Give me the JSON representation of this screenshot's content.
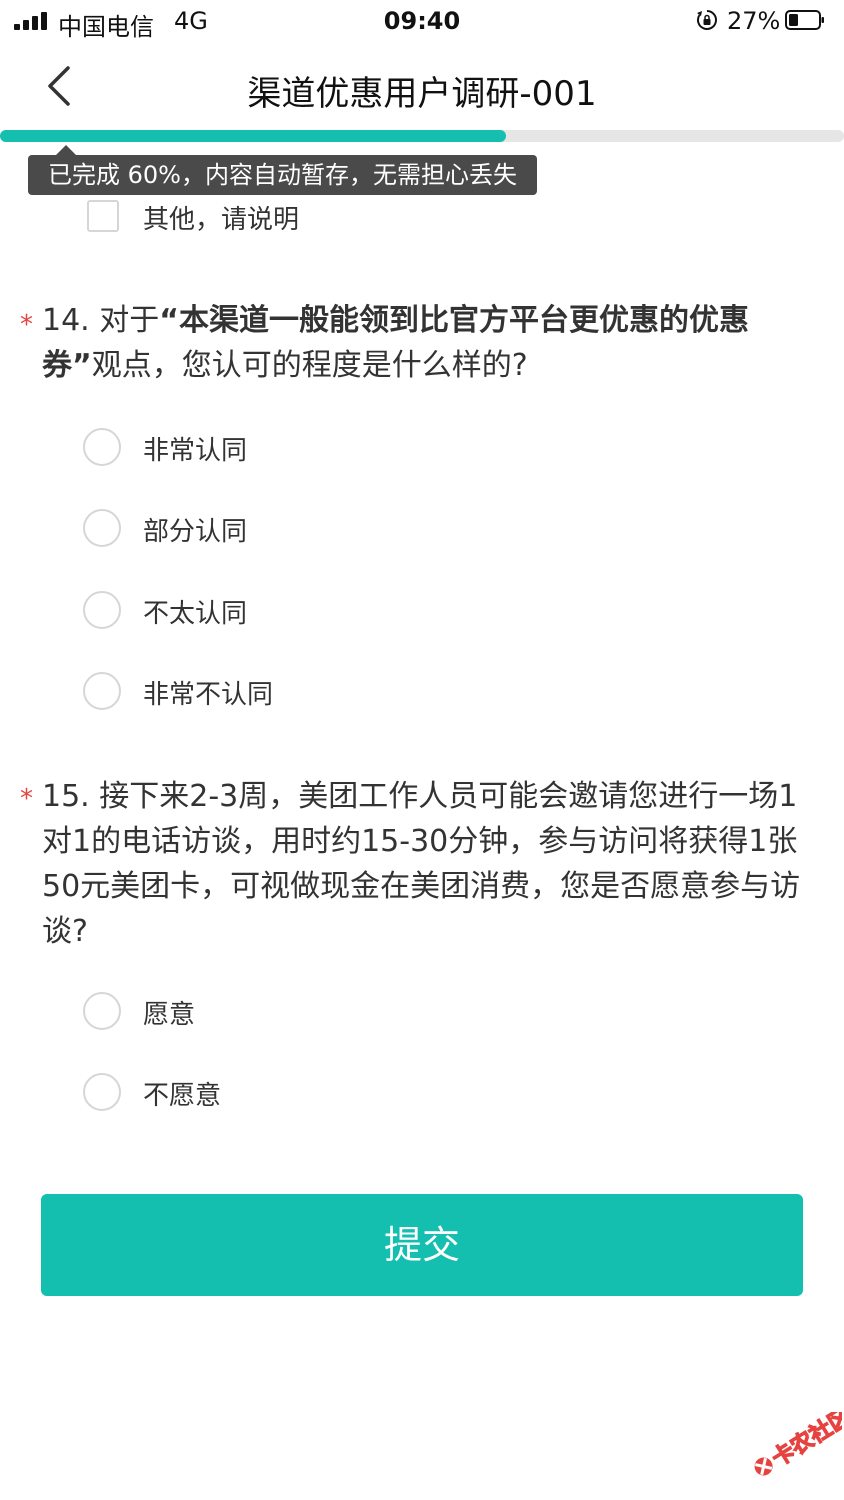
{
  "statusbar": {
    "carrier": "中国电信",
    "network": "4G",
    "time": "09:40",
    "battery": "27%"
  },
  "nav": {
    "title": "渠道优惠用户调研-001"
  },
  "progress": {
    "value": 0.6,
    "tooltip": "已完成 60%，内容自动暂存，无需担心丢失"
  },
  "prev_option": {
    "label": "其他，请说明"
  },
  "q14": {
    "required_mark": "*",
    "number": "14. 对于",
    "emph": "“本渠道一般能领到比官方平台更优惠的优惠券”",
    "rest": "观点，您认可的程度是什么样的?",
    "options": [
      "非常认同",
      "部分认同",
      "不太认同",
      "非常不认同"
    ]
  },
  "q15": {
    "required_mark": "*",
    "text": "15. 接下来2-3周，美团工作人员可能会邀请您进行一场1对1的电话访谈，用时约15-30分钟，参与访问将获得1张50元美团卡，可视做现金在美团消费，您是否愿意参与访谈?",
    "options": [
      "愿意",
      "不愿意"
    ]
  },
  "submit_label": "提交",
  "watermark": {
    "text": "卡农社区",
    "icon": "kanong-logo-icon"
  },
  "colors": {
    "accent": "#14bfb0",
    "required": "#e64340",
    "tooltip_bg": "#4a4a4a"
  }
}
